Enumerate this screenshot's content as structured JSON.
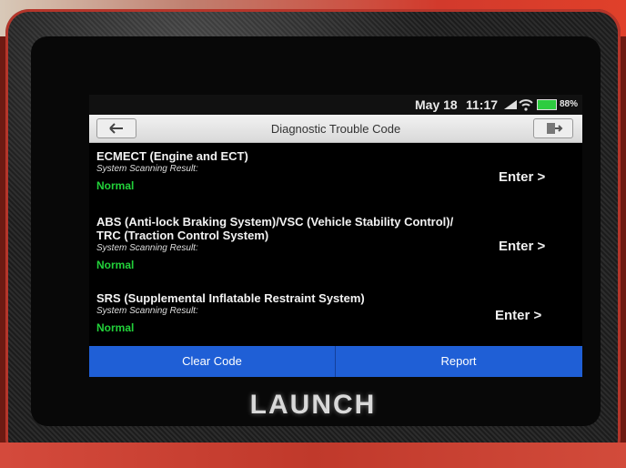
{
  "device": {
    "brand": "LAUNCH"
  },
  "status_bar": {
    "date": "May 18",
    "time": "11:17",
    "battery": "88%"
  },
  "header": {
    "title": "Diagnostic Trouble Code",
    "back_icon": "back-arrow-icon",
    "exit_icon": "exit-icon"
  },
  "systems": [
    {
      "name": "ECMECT (Engine and ECT)",
      "result_label": "System Scanning Result:",
      "status": "Normal",
      "action": "Enter >"
    },
    {
      "name": "ABS (Anti-lock Braking System)/VSC (Vehicle Stability Control)/",
      "name2": "TRC (Traction Control System)",
      "result_label": "System Scanning Result:",
      "status": "Normal",
      "action": "Enter >"
    },
    {
      "name": "SRS (Supplemental Inflatable Restraint System)",
      "result_label": "System Scanning Result:",
      "status": "Normal",
      "action": "Enter >"
    }
  ],
  "footer": {
    "clear_code": "Clear Code",
    "report": "Report"
  },
  "colors": {
    "accent": "#1f5fd6",
    "normal_status": "#22d13a"
  }
}
